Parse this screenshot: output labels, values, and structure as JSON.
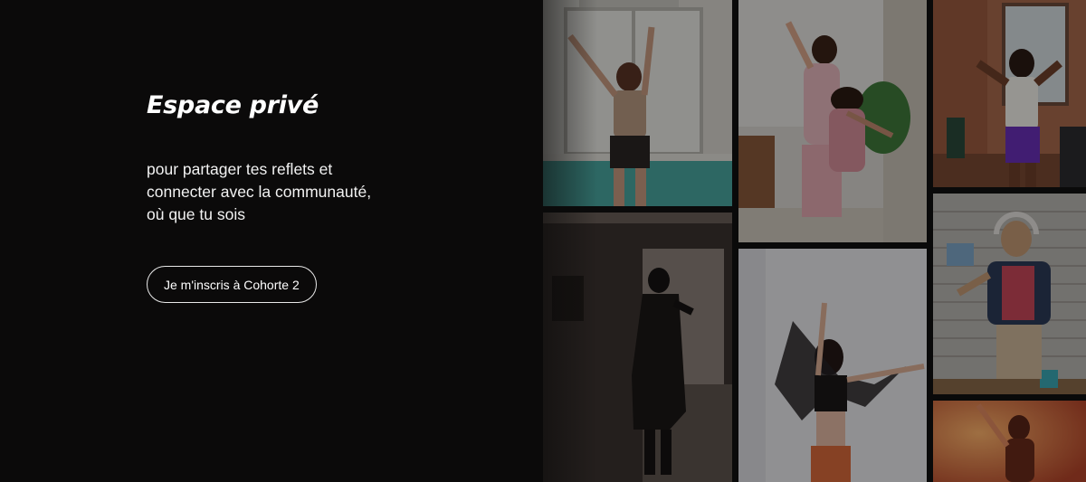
{
  "hero": {
    "title": "Espace privé",
    "subtitle_lines": [
      "pour partager tes reflets et",
      "connecter avec la communauté,",
      "où que tu sois"
    ],
    "cta_label": "Je m'inscris à Cohorte 2"
  },
  "collage": {
    "photos": [
      "dancing-woman-window-photo",
      "mother-daughter-dancing-photo",
      "woman-dancing-livingroom-photo",
      "silhouette-dancing-photo",
      "woman-dancing-white-wall-photo",
      "woman-headphones-dancing-photo",
      "woman-dancing-orange-light-photo"
    ]
  },
  "colors": {
    "background": "#0b0a0a",
    "text": "#ffffff",
    "button_border": "#e9e9e9"
  }
}
